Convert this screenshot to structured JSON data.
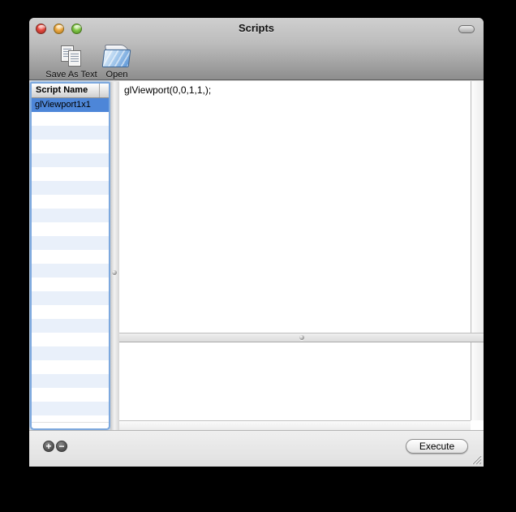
{
  "window": {
    "title": "Scripts"
  },
  "titlebar": {
    "close": "close",
    "minimize": "minimize",
    "zoom": "zoom",
    "toolbar_pill": "toggle-toolbar"
  },
  "toolbar": {
    "save_as_text_label": "Save As Text",
    "open_label": "Open"
  },
  "sidebar": {
    "header_label": "Script Name",
    "items": [
      {
        "label": "glViewport1x1",
        "selected": true
      }
    ],
    "visible_row_slots": 23
  },
  "editor": {
    "content": "glViewport(0,0,1,1,);"
  },
  "output": {
    "content": ""
  },
  "bottom_bar": {
    "add_label": "+",
    "remove_label": "−",
    "execute_label": "Execute"
  },
  "colors": {
    "selection_blue": "#4D86D8",
    "row_stripe_blue": "#E9F0FA",
    "focus_ring_blue": "#7CA8DE",
    "titlebar_top": "#CFCFCF",
    "titlebar_bottom": "#8D8D8D"
  }
}
